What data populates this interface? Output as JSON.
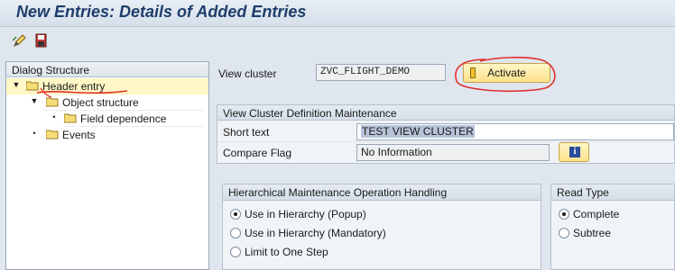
{
  "window": {
    "title": "New Entries: Details of Added Entries"
  },
  "toolbar": {
    "icons": [
      "edit-icon",
      "save-icon"
    ]
  },
  "dialog_structure": {
    "title": "Dialog Structure",
    "items": [
      {
        "label": "Header entry",
        "level": 0,
        "expanded": true,
        "selected": true
      },
      {
        "label": "Object structure",
        "level": 1,
        "expanded": true,
        "selected": false
      },
      {
        "label": "Field dependence",
        "level": 2,
        "expanded": false,
        "selected": false
      },
      {
        "label": "Events",
        "level": 0,
        "expanded": false,
        "selected": false
      }
    ]
  },
  "view_cluster": {
    "label": "View cluster",
    "value": "ZVC_FLIGHT_DEMO",
    "activate_label": "Activate"
  },
  "definition": {
    "title": "View Cluster Definition Maintenance",
    "short_text_label": "Short text",
    "short_text_value": "TEST VIEW CLUSTER",
    "compare_flag_label": "Compare Flag",
    "compare_flag_value": "No Information"
  },
  "hierarchical": {
    "title": "Hierarchical Maintenance Operation Handling",
    "options": [
      "Use in Hierarchy (Popup)",
      "Use in Hierarchy (Mandatory)",
      "Limit to One Step"
    ],
    "selected_index": 0
  },
  "read_type": {
    "title": "Read Type",
    "options": [
      "Complete",
      "Subtree"
    ],
    "selected_index": 0
  },
  "colors": {
    "title": "#1d3d6b",
    "accent": "#fde28a",
    "selection": "#fff7c6",
    "annotation": "#e03030"
  }
}
